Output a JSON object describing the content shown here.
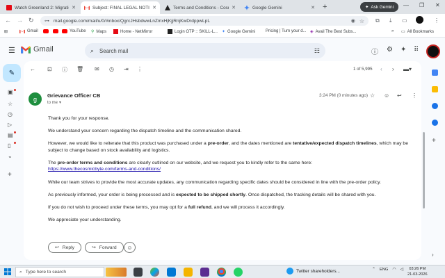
{
  "browser": {
    "tabs": [
      {
        "title": "Watch Greenland 2: Migration",
        "favicon": "red-square"
      },
      {
        "title": "Subject: FINAL LEGAL NOTICE",
        "favicon": "gmail",
        "active": true
      },
      {
        "title": "Terms and Conditions - Cosmic",
        "favicon": "cosmic"
      },
      {
        "title": "Google Gemini",
        "favicon": "gemini"
      }
    ],
    "new_tab": "+",
    "ask_gemini": "Ask Gemini",
    "url": "mail.google.com/mail/u/0/#inbox/QgrcJHsbdwwLnZmxHjKjjRnjKwDrdppwLpL",
    "bookmarks": [
      "Gmail",
      "YouTube",
      "Maps",
      "Home - NetMirror",
      "Login OTP :: SKILL-L...",
      "Google Gemini",
      "Pricing | Turn your d...",
      "Avail The Best Subs..."
    ],
    "all_bookmarks": "All Bookmarks",
    "overflow": "»"
  },
  "gmail": {
    "logo_text": "Gmail",
    "search_placeholder": "Search mail",
    "pager": "1 of 5,995"
  },
  "email": {
    "sender_initial": "g",
    "sender_name": "Grievance Officer CB",
    "to": "to me",
    "time": "3:24 PM (0 minutes ago)",
    "paragraphs": {
      "p1": "Thank you for your response.",
      "p2": "We understand your concern regarding the dispatch timeline and the communication shared.",
      "p3a": "However, we would like to reiterate that this product was purchased under a ",
      "p3b": "pre-order",
      "p3c": ", and the dates mentioned are ",
      "p3d": "tentative/expected dispatch timelines",
      "p3e": ", which may be subject to change based on stock availability and logistics.",
      "p4a": "The ",
      "p4b": "pre-order terms and conditions",
      "p4c": " are clearly outlined on our website, and we request you to kindly refer to the same here:",
      "p4link": "https://www.thecosmicbyte.com/terms-and-conditions/",
      "p5": "While our team strives to provide the most accurate updates, any communication regarding specific dates should be considered in line with the pre-order policy.",
      "p6a": "As previously informed, your order is being processed and is ",
      "p6b": "expected to be shipped shortly",
      "p6c": ". Once dispatched, the tracking details will be shared with you.",
      "p7a": "If you do not wish to proceed under these terms, you may opt for a ",
      "p7b": "full refund",
      "p7c": ", and we will process it accordingly.",
      "p8": "We appreciate your understanding."
    },
    "reply_label": "Reply",
    "forward_label": "Forward"
  },
  "taskbar": {
    "search_placeholder": "Type here to search",
    "weather": "Twitter shareholders...",
    "lang": "ENG",
    "time": "03:26 PM",
    "date": "21-03-2026"
  },
  "colors": {
    "gmail_red": "#ea4335",
    "compose_bg": "#c2e7ff",
    "sender_avatar": "#1e8e3e",
    "link": "#1a0dab"
  }
}
